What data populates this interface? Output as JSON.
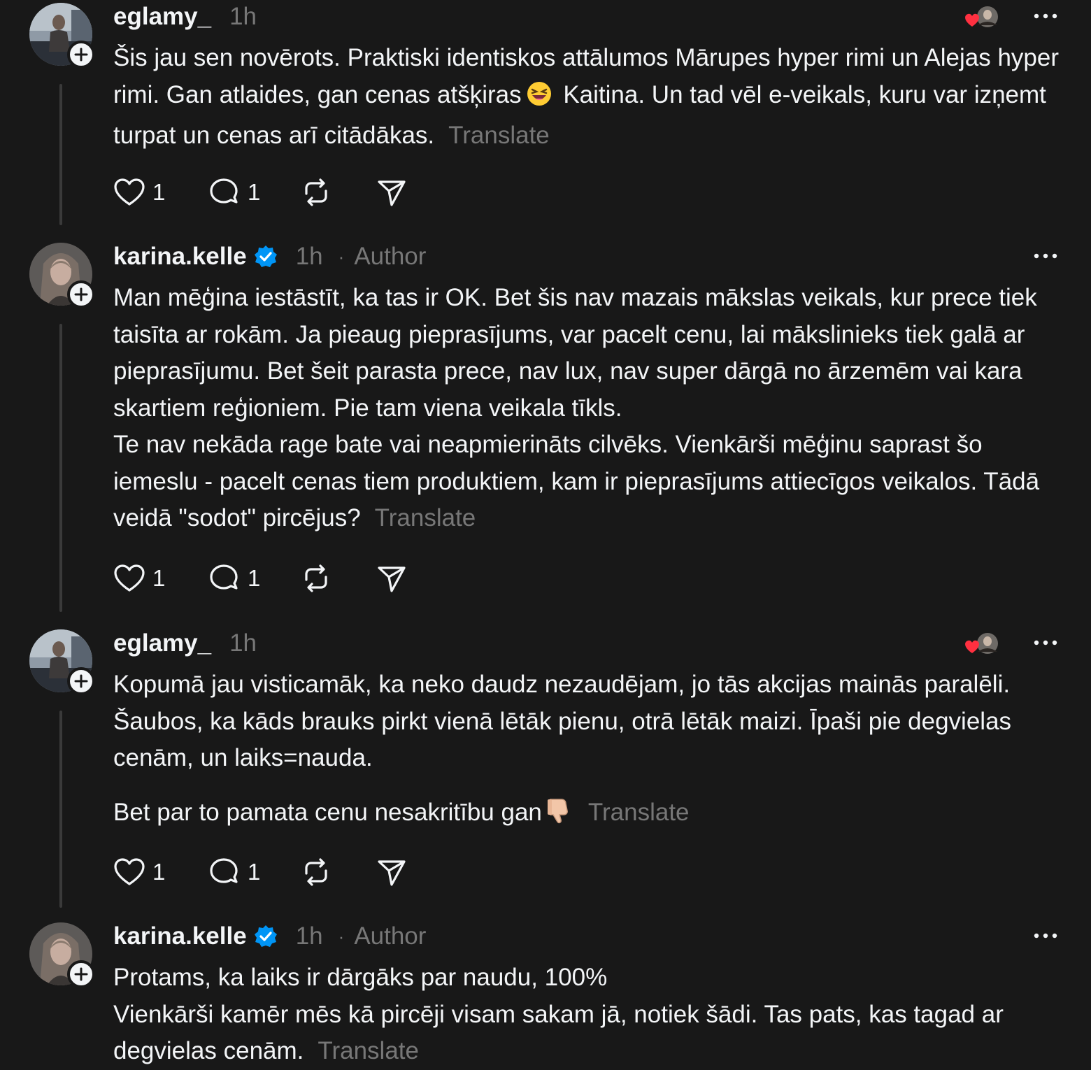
{
  "posts": [
    {
      "username": "eglamy_",
      "time": "1h",
      "verified": false,
      "author_tag": "",
      "body_parts": {
        "before_emoji": "Šis jau sen novērots. Praktiski identiskos attālumos Mārupes hyper rimi un Alejas hyper rimi. Gan atlaides, gan cenas atšķiras",
        "emoji_icon": "grinning-squinting-face-emoji",
        "after_emoji": " Kaitina. Un tad vēl e-veikals, kuru var izņemt turpat un cenas arī citādākas."
      },
      "translate": "Translate",
      "likes": "1",
      "replies": "1",
      "liked_by_author": true
    },
    {
      "username": "karina.kelle",
      "time": "1h",
      "verified": true,
      "author_tag": "Author",
      "body": "Man mēģina iestāstīt, ka tas ir OK. Bet šis nav mazais mākslas veikals, kur prece tiek taisīta ar rokām. Ja pieaug pieprasījums, var pacelt cenu, lai mākslinieks tiek galā ar pieprasījumu. Bet šeit parasta prece, nav lux, nav super dārgā no ārzemēm vai kara skartiem reģioniem. Pie tam viena veikala tīkls.\nTe nav nekāda rage bate vai neapmierināts cilvēks. Vienkārši mēģinu saprast šo iemeslu - pacelt cenas tiem produktiem, kam ir pieprasījums attiecīgos veikalos. Tādā veidā \"sodot\" pircējus?",
      "translate": "Translate",
      "likes": "1",
      "replies": "1",
      "liked_by_author": false
    },
    {
      "username": "eglamy_",
      "time": "1h",
      "verified": false,
      "author_tag": "",
      "body": "Kopumā jau visticamāk, ka neko daudz nezaudējam, jo tās akcijas mainās paralēli. Šaubos, ka kāds brauks pirkt vienā lētāk pienu, otrā lētāk maizi. Īpaši pie degvielas cenām, un laiks=nauda.",
      "body_second": "Bet par to pamata cenu nesakritību gan",
      "emoji_icon": "thumbs-down-emoji",
      "translate": "Translate",
      "likes": "1",
      "replies": "1",
      "liked_by_author": true
    },
    {
      "username": "karina.kelle",
      "time": "1h",
      "verified": true,
      "author_tag": "Author",
      "body": "Protams, ka laiks ir dārgāks par naudu, 100%\nVienkārši kamēr mēs kā pircēji visam sakam jā, notiek šādi. Tas pats, kas tagad ar degvielas cenām.",
      "translate": "Translate",
      "liked_by_author": false
    }
  ],
  "colors": {
    "background": "#181818",
    "text": "#f3f5f7",
    "muted": "#777777",
    "thread_line": "#3a3a3a",
    "verified_blue": "#0095f6",
    "heart_red": "#ff3040"
  },
  "icons": {
    "like": "heart-icon",
    "reply": "comment-bubble-icon",
    "repost": "repost-icon",
    "share": "send-icon",
    "more": "more-dots-icon",
    "follow": "plus-icon",
    "verified": "verified-badge-icon"
  }
}
